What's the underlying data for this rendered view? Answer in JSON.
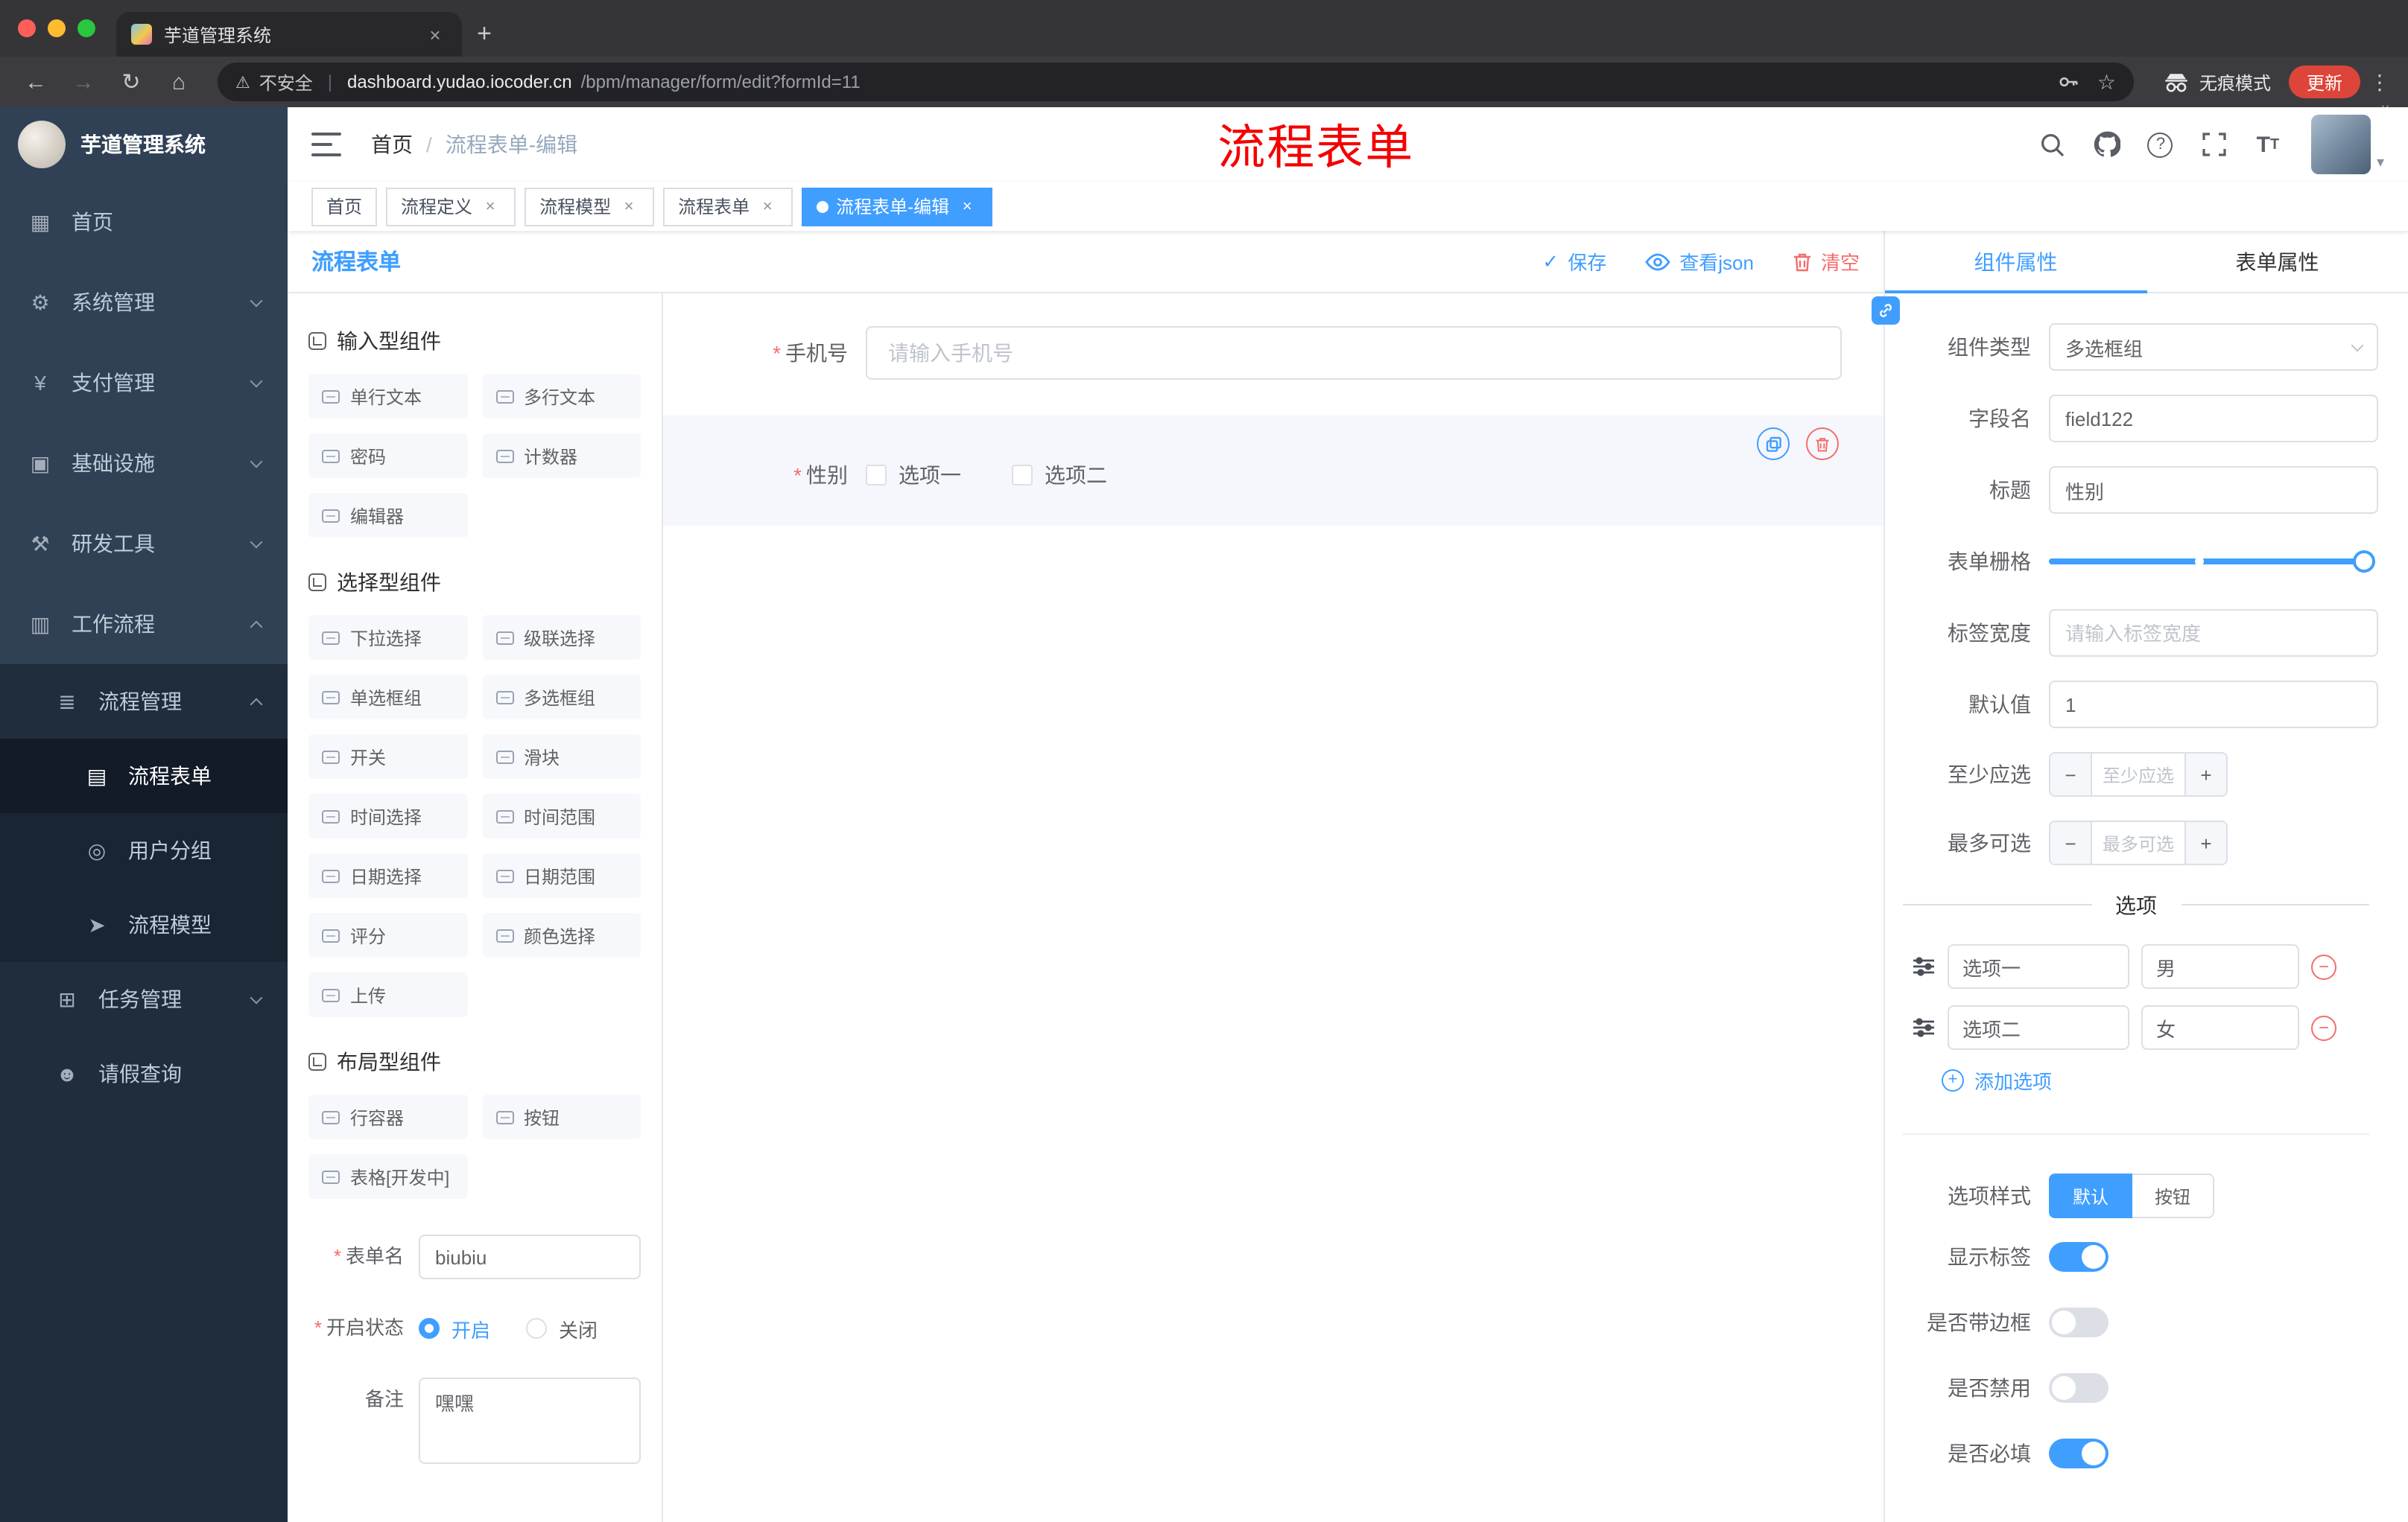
{
  "colors": {
    "accent": "#409eff",
    "danger": "#f56c6c",
    "watermark": "#f40000",
    "sidebar_bg": "#304156"
  },
  "ui": {
    "close": "×",
    "plus": "+",
    "minus": "−",
    "check": "✓",
    "back": "←",
    "forward": "→",
    "reload": "↻",
    "home": "⌂",
    "star": "☆",
    "kebab": "⋮",
    "warning": "⚠",
    "caret": "▾",
    "chevron": "∨",
    "question": "?",
    "font_large": "T",
    "font_small": "T"
  },
  "browser": {
    "tab_title": "芋道管理系统",
    "security_label": "不安全",
    "url_domain": "dashboard.yudao.iocoder.cn",
    "url_path": "/bpm/manager/form/edit?formId=11",
    "incognito_label": "无痕模式",
    "update_label": "更新"
  },
  "sidebar": {
    "logo_title": "芋道管理系统",
    "top_items": [
      {
        "label": "首页",
        "icon": "dashboard-icon",
        "glyph": "▦"
      },
      {
        "label": "系统管理",
        "icon": "gear-icon",
        "glyph": "⚙"
      },
      {
        "label": "支付管理",
        "icon": "payment-icon",
        "glyph": "¥"
      },
      {
        "label": "基础设施",
        "icon": "infrastructure-icon",
        "glyph": "▣"
      },
      {
        "label": "研发工具",
        "icon": "devtools-icon",
        "glyph": "⚒"
      },
      {
        "label": "工作流程",
        "icon": "workflow-icon",
        "glyph": "▥"
      }
    ],
    "submenu": {
      "process_mgmt": {
        "label": "流程管理",
        "glyph": "≣"
      },
      "process_form": {
        "label": "流程表单",
        "glyph": "▤"
      },
      "user_group": {
        "label": "用户分组",
        "glyph": "◎"
      },
      "process_model": {
        "label": "流程模型",
        "glyph": "➤"
      },
      "task_mgmt": {
        "label": "任务管理",
        "glyph": "⊞"
      },
      "leave_query": {
        "label": "请假查询",
        "glyph": "☻"
      }
    }
  },
  "header": {
    "breadcrumb_home": "首页",
    "breadcrumb_sep": "/",
    "breadcrumb_current": "流程表单-编辑",
    "watermark": "流程表单"
  },
  "tags": [
    {
      "label": "首页",
      "closable": false,
      "active": false
    },
    {
      "label": "流程定义",
      "closable": true,
      "active": false
    },
    {
      "label": "流程模型",
      "closable": true,
      "active": false
    },
    {
      "label": "流程表单",
      "closable": true,
      "active": false
    },
    {
      "label": "流程表单-编辑",
      "closable": true,
      "active": true
    }
  ],
  "designer": {
    "title": "流程表单",
    "actions": {
      "save": "保存",
      "view_json": "查看json",
      "clear": "清空"
    },
    "palette": {
      "groups": [
        {
          "title": "输入型组件",
          "items": [
            "单行文本",
            "多行文本",
            "密码",
            "计数器",
            "编辑器"
          ]
        },
        {
          "title": "选择型组件",
          "items": [
            "下拉选择",
            "级联选择",
            "单选框组",
            "多选框组",
            "开关",
            "滑块",
            "时间选择",
            "时间范围",
            "日期选择",
            "日期范围",
            "评分",
            "颜色选择",
            "上传"
          ]
        },
        {
          "title": "布局型组件",
          "items": [
            "行容器",
            "按钮",
            "表格[开发中]"
          ]
        }
      ]
    },
    "meta": {
      "form_name_label": "表单名",
      "form_name_value": "biubiu",
      "status_label": "开启状态",
      "status_on": "开启",
      "status_off": "关闭",
      "remark_label": "备注",
      "remark_value": "嘿嘿"
    },
    "canvas": {
      "phone": {
        "label": "手机号",
        "placeholder": "请输入手机号"
      },
      "gender": {
        "label": "性别",
        "option1": "选项一",
        "option2": "选项二"
      }
    }
  },
  "props": {
    "tab_component": "组件属性",
    "tab_form": "表单属性",
    "component_type_label": "组件类型",
    "component_type_value": "多选框组",
    "field_name_label": "字段名",
    "field_name_value": "field122",
    "title_label": "标题",
    "title_value": "性别",
    "grid_label": "表单栅格",
    "label_width_label": "标签宽度",
    "label_width_placeholder": "请输入标签宽度",
    "default_label": "默认值",
    "default_value": "1",
    "min_label": "至少应选",
    "min_placeholder": "至少应选",
    "max_label": "最多可选",
    "max_placeholder": "最多可选",
    "options_title": "选项",
    "option_rows": [
      {
        "label": "选项一",
        "value": "男"
      },
      {
        "label": "选项二",
        "value": "女"
      }
    ],
    "add_option": "添加选项",
    "style_label": "选项样式",
    "style_default": "默认",
    "style_button": "按钮",
    "toggle_rows": [
      {
        "label": "显示标签",
        "on": true
      },
      {
        "label": "是否带边框",
        "on": false
      },
      {
        "label": "是否禁用",
        "on": false
      },
      {
        "label": "是否必填",
        "on": true
      }
    ]
  }
}
